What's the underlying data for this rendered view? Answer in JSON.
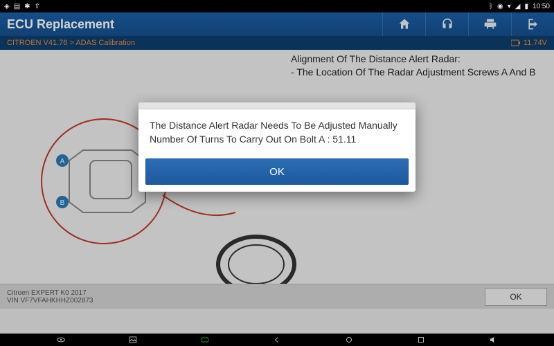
{
  "status": {
    "time": "10:50"
  },
  "header": {
    "title": "ECU Replacement"
  },
  "breadcrumb": {
    "path": "CITROEN V41.76 > ADAS Calibration",
    "voltage": "11.74V"
  },
  "instruction": {
    "line1": "Alignment Of The Distance Alert Radar:",
    "line2": "- The Location Of The Radar Adjustment Screws A And B"
  },
  "footer": {
    "vehicle": "Citroen EXPERT K0 2017",
    "vin": "VIN VF7VFAHKHHZ002873",
    "ok": "OK"
  },
  "dialog": {
    "line1": "The Distance Alert Radar Needs To Be Adjusted Manually",
    "line2": "Number Of Turns To Carry Out On Bolt A : 51.11",
    "ok": "OK"
  }
}
